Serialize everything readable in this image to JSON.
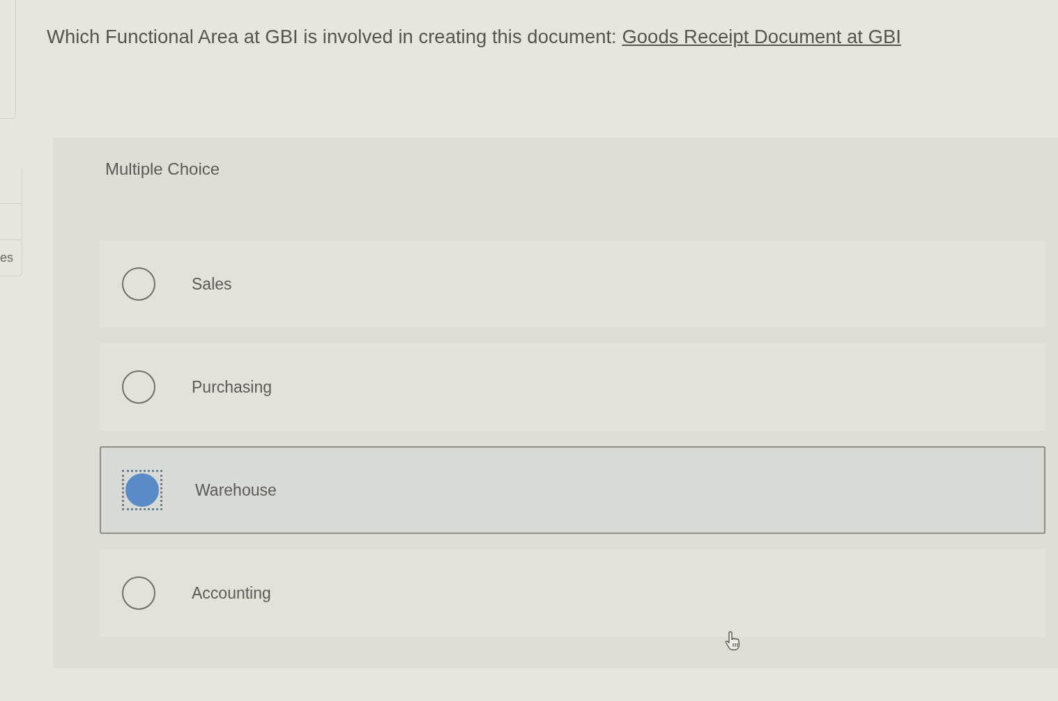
{
  "side_tab": {
    "label": "es"
  },
  "question": {
    "text": "Which Functional Area at GBI is involved in creating this document:",
    "link": "Goods Receipt Document at GBI"
  },
  "card": {
    "type_label": "Multiple Choice",
    "options": [
      {
        "label": "Sales",
        "selected": false
      },
      {
        "label": "Purchasing",
        "selected": false
      },
      {
        "label": "Warehouse",
        "selected": true
      },
      {
        "label": "Accounting",
        "selected": false
      }
    ]
  }
}
